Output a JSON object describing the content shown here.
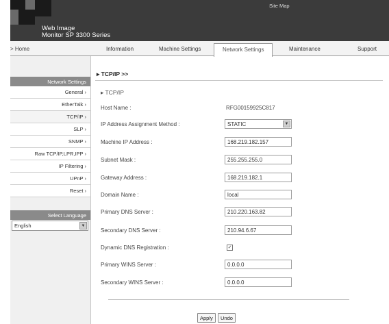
{
  "header": {
    "title_line1": "Web Image",
    "title_line2": "Monitor SP 3300 Series",
    "sitemap_label": "Site Map"
  },
  "nav": {
    "home": "> Home",
    "tabs": [
      "Information",
      "Machine Settings",
      "Network Settings",
      "Maintenance",
      "Support"
    ],
    "active_tab": "Network Settings"
  },
  "sidebar": {
    "section_title": "Network Settings",
    "items": [
      "General",
      "EtherTalk",
      "TCP/IP",
      "SLP",
      "SNMP",
      "Raw TCP/IP,LPR,IPP",
      "IP Filtering",
      "UPnP",
      "Reset"
    ],
    "active_item": "TCP/IP",
    "language_title": "Select Language",
    "language_value": "English"
  },
  "main": {
    "breadcrumb": "TCP/IP >>",
    "section_title": "TCP/IP",
    "fields": {
      "host_name_label": "Host Name :",
      "host_name_value": "RFG00159925C817",
      "ip_method_label": "IP Address Assignment Method :",
      "ip_method_value": "STATIC",
      "machine_ip_label": "Machine IP Address :",
      "machine_ip_value": "168.219.182.157",
      "subnet_label": "Subnet Mask :",
      "subnet_value": "255.255.255.0",
      "gateway_label": "Gateway Address :",
      "gateway_value": "168.219.182.1",
      "domain_label": "Domain Name :",
      "domain_value": "local",
      "dns1_label": "Primary DNS Server :",
      "dns1_value": "210.220.163.82",
      "dns2_label": "Secondary DNS Server :",
      "dns2_value": "210.94.6.67",
      "ddns_label": "Dynamic DNS Registration :",
      "ddns_checked": true,
      "wins1_label": "Primary WINS Server :",
      "wins1_value": "0.0.0.0",
      "wins2_label": "Secondary WINS Server :",
      "wins2_value": "0.0.0.0"
    },
    "apply_label": "Apply",
    "undo_label": "Undo"
  },
  "icons": [
    "logo-blocks",
    "chevron-down-icon",
    "checkbox-checked-icon"
  ]
}
